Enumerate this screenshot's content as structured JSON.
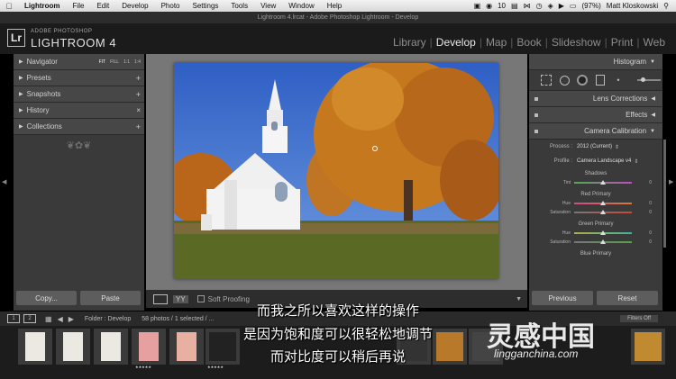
{
  "menubar": {
    "app_name": "Lightroom",
    "items": [
      "File",
      "Edit",
      "Develop",
      "Photo",
      "Settings",
      "Tools",
      "View",
      "Window",
      "Help"
    ],
    "status": {
      "badge": "10",
      "battery": "(97%)",
      "user": "Matt Kloskowski"
    }
  },
  "window": {
    "title": "Lightroom 4.lrcat - Adobe Photoshop Lightroom - Develop"
  },
  "identity": {
    "badge": "Lr",
    "top_line": "ADOBE PHOTOSHOP",
    "product": "LIGHTROOM 4"
  },
  "modules": {
    "items": [
      "Library",
      "Develop",
      "Map",
      "Book",
      "Slideshow",
      "Print",
      "Web"
    ],
    "active": "Develop"
  },
  "left_panel": {
    "navigator": {
      "label": "Navigator",
      "options": [
        "FIT",
        "FILL",
        "1:1",
        "1:4"
      ]
    },
    "presets": "Presets",
    "snapshots": "Snapshots",
    "history": "History",
    "collections": "Collections",
    "copy_label": "Copy...",
    "paste_label": "Paste"
  },
  "toolbar": {
    "soft_proofing": "Soft Proofing",
    "view_mode": "YY"
  },
  "right_panel": {
    "histogram": "Histogram",
    "lens_corrections": "Lens Corrections",
    "effects": "Effects",
    "camera_calibration": "Camera Calibration",
    "process_label": "Process :",
    "process_value": "2012 (Current)",
    "profile_label": "Profile :",
    "profile_value": "Camera Landscape v4",
    "shadows": {
      "title": "Shadows",
      "tint_label": "Tint",
      "tint_value": "0",
      "tint_pos": 0.5
    },
    "red_primary": {
      "title": "Red Primary",
      "hue_label": "Hue",
      "hue_value": "0",
      "sat_label": "Saturation",
      "sat_value": "0",
      "hue_pos": 0.5,
      "sat_pos": 0.5
    },
    "green_primary": {
      "title": "Green Primary",
      "hue_label": "Hue",
      "hue_value": "0",
      "sat_label": "Saturation",
      "sat_value": "0",
      "hue_pos": 0.5,
      "sat_pos": 0.5
    },
    "blue_primary": {
      "title": "Blue Primary"
    },
    "previous_label": "Previous",
    "reset_label": "Reset"
  },
  "filmstrip_bar": {
    "monitor_1": "1",
    "monitor_2": "2",
    "folder": "Folder : Develop",
    "count": "58 photos / 1 selected / ...",
    "filter": "Filters Off"
  },
  "subtitles": {
    "line1": "而我之所以喜欢这样的操作",
    "line2": "是因为饱和度可以很轻松地调节",
    "line3": "而对比度可以稍后再说"
  },
  "watermark": {
    "main": "灵感中国",
    "url": "lingganchina.com"
  },
  "colors": {
    "panel": "#3a3a3a",
    "sky": "#3f6fcb",
    "foliage": "#c6781e",
    "grass": "#5a6a25",
    "red_slider": "#c8483c",
    "green_slider": "#5aa04a",
    "blue_slider": "#4a6ac8"
  }
}
